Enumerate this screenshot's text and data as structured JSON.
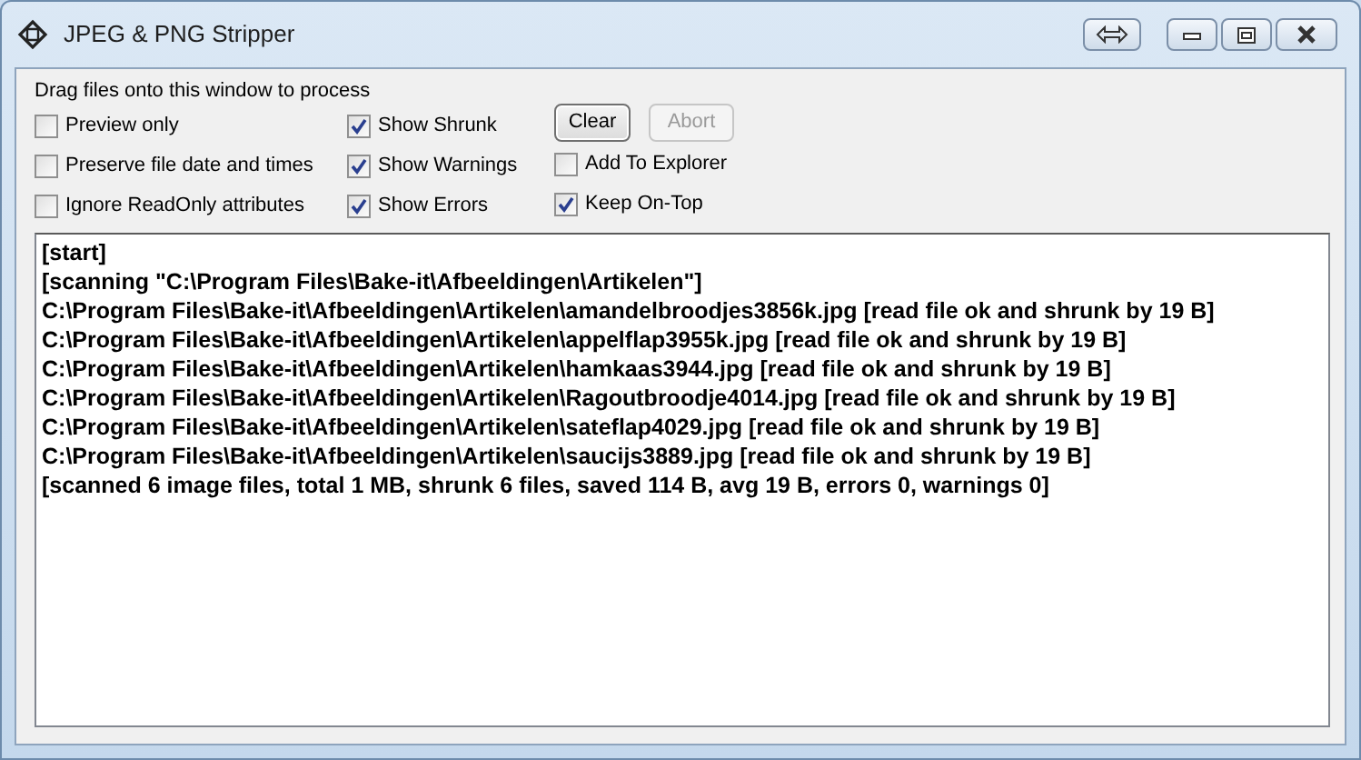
{
  "window": {
    "title": "JPEG & PNG Stripper"
  },
  "instruction": "Drag files onto this window to process",
  "options": [
    {
      "label": "Preview only",
      "checked": false
    },
    {
      "label": "Show Shrunk",
      "checked": true
    },
    {
      "label": "Preserve file date and times",
      "checked": false
    },
    {
      "label": "Show Warnings",
      "checked": true
    },
    {
      "label": "Add To Explorer",
      "checked": false
    },
    {
      "label": "Ignore ReadOnly attributes",
      "checked": false
    },
    {
      "label": "Show Errors",
      "checked": true
    },
    {
      "label": "Keep On-Top",
      "checked": true
    }
  ],
  "buttons": [
    {
      "label": "Clear",
      "disabled": false
    },
    {
      "label": "Abort",
      "disabled": true
    }
  ],
  "log": [
    "[start]",
    "[scanning \"C:\\Program Files\\Bake-it\\Afbeeldingen\\Artikelen\"]",
    "C:\\Program Files\\Bake-it\\Afbeeldingen\\Artikelen\\amandelbroodjes3856k.jpg [read file ok and shrunk by 19 B]",
    "C:\\Program Files\\Bake-it\\Afbeeldingen\\Artikelen\\appelflap3955k.jpg [read file ok and shrunk by 19 B]",
    "C:\\Program Files\\Bake-it\\Afbeeldingen\\Artikelen\\hamkaas3944.jpg [read file ok and shrunk by 19 B]",
    "C:\\Program Files\\Bake-it\\Afbeeldingen\\Artikelen\\Ragoutbroodje4014.jpg [read file ok and shrunk by 19 B]",
    "C:\\Program Files\\Bake-it\\Afbeeldingen\\Artikelen\\sateflap4029.jpg [read file ok and shrunk by 19 B]",
    "C:\\Program Files\\Bake-it\\Afbeeldingen\\Artikelen\\saucijs3889.jpg [read file ok and shrunk by 19 B]",
    "[scanned 6 image files, total 1 MB, shrunk 6 files, saved 114 B, avg 19 B, errors 0, warnings 0]"
  ]
}
